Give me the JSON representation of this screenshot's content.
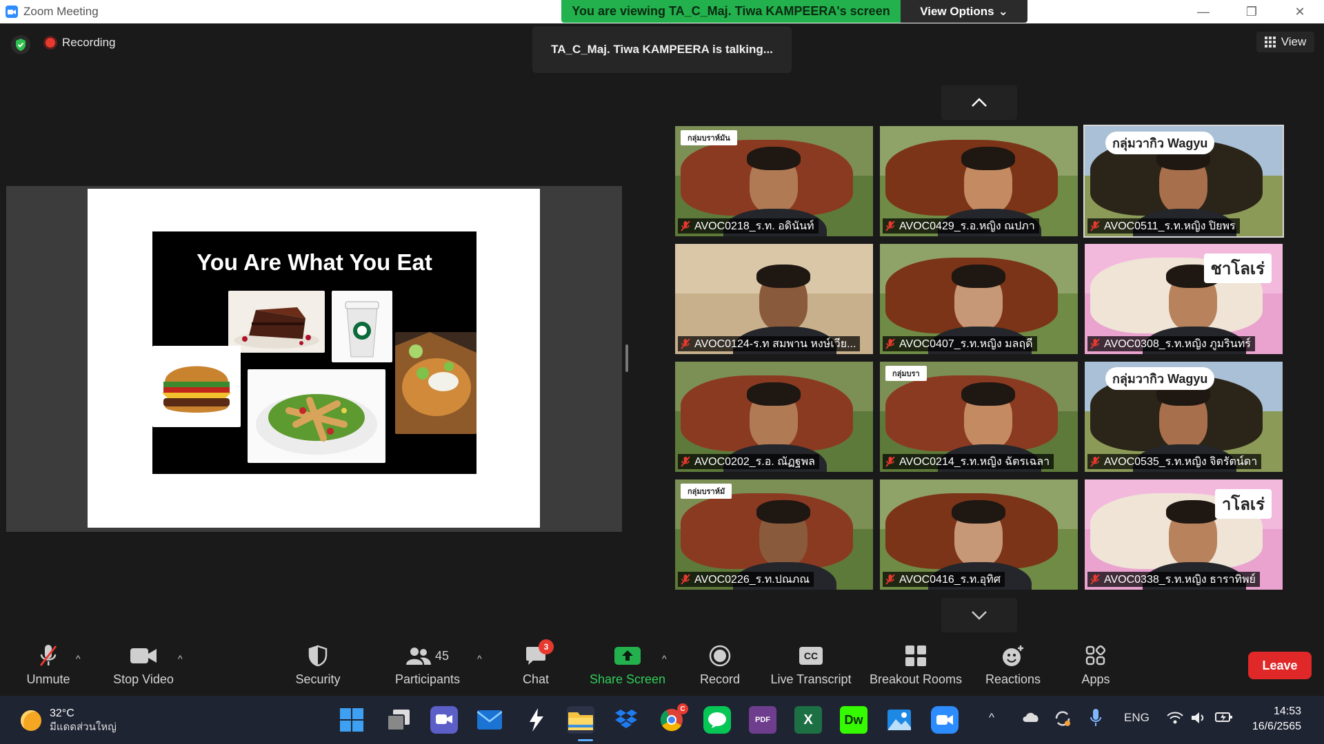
{
  "window": {
    "title": "Zoom Meeting",
    "viewing_banner": "You are viewing TA_C_Maj. Tiwa KAMPEERA's screen",
    "view_options": "View Options"
  },
  "status": {
    "recording": "Recording",
    "talking": "TA_C_Maj. Tiwa KAMPEERA is talking...",
    "view": "View"
  },
  "slide": {
    "title": "You Are What You Eat"
  },
  "participants": [
    {
      "name": "AVOC0218_ร.ท. อดินันท์",
      "bg": "cow-red",
      "sign": "กลุ่มบราห์มัน"
    },
    {
      "name": "AVOC0429_ร.อ.หญิง ณปภา",
      "bg": "cow-field",
      "sign": ""
    },
    {
      "name": "AVOC0511_ร.ท.หญิง ปิยพร",
      "bg": "wagyu",
      "sign": "กลุ่มวากิว Wagyu"
    },
    {
      "name": "AVOC0124-ร.ท สมพาน หงษ์เวีย...",
      "bg": "room",
      "sign": ""
    },
    {
      "name": "AVOC0407_ร.ท.หญิง มลฤดี",
      "bg": "cow-field",
      "sign": ""
    },
    {
      "name": "AVOC0308_ร.ท.หญิง ภูมรินทร์",
      "bg": "charolais",
      "sign": "ชาโลเร่"
    },
    {
      "name": "AVOC0202_ร.อ. ณัฏฐพล",
      "bg": "cow-red",
      "sign": ""
    },
    {
      "name": "AVOC0214_ร.ท.หญิง ฉัตรเฉลา",
      "bg": "cow-red",
      "sign": "กลุ่มบรา"
    },
    {
      "name": "AVOC0535_ร.ท.หญิง จิตรัตน์ดา",
      "bg": "wagyu",
      "sign": "กลุ่มวากิว Wagyu"
    },
    {
      "name": "AVOC0226_ร.ท.ปณภณ",
      "bg": "cow-red",
      "sign": "กลุ่มบราห์มั"
    },
    {
      "name": "AVOC0416_ร.ท.อุทิศ",
      "bg": "cow-field",
      "sign": ""
    },
    {
      "name": "AVOC0338_ร.ท.หญิง ธาราทิพย์",
      "bg": "charolais",
      "sign": "าโลเร่"
    }
  ],
  "toolbar": {
    "unmute": "Unmute",
    "stop_video": "Stop Video",
    "security": "Security",
    "participants": "Participants",
    "participants_count": "45",
    "chat": "Chat",
    "chat_badge": "3",
    "share_screen": "Share Screen",
    "record": "Record",
    "live_transcript": "Live Transcript",
    "cc": "CC",
    "breakout_rooms": "Breakout Rooms",
    "reactions": "Reactions",
    "apps": "Apps",
    "leave": "Leave"
  },
  "taskbar": {
    "temp": "32°C",
    "condition": "มีแดดส่วนใหญ่",
    "lang": "ENG",
    "time": "14:53",
    "date": "16/6/2565",
    "dw": "Dw",
    "excel": "X",
    "pdf": "PDF",
    "chrome_badge": "C"
  },
  "colors": {
    "accent_green": "#22b14c",
    "leave_red": "#e02828",
    "zoom_blue": "#2d8cff",
    "mic_off_red": "#e8392f"
  }
}
